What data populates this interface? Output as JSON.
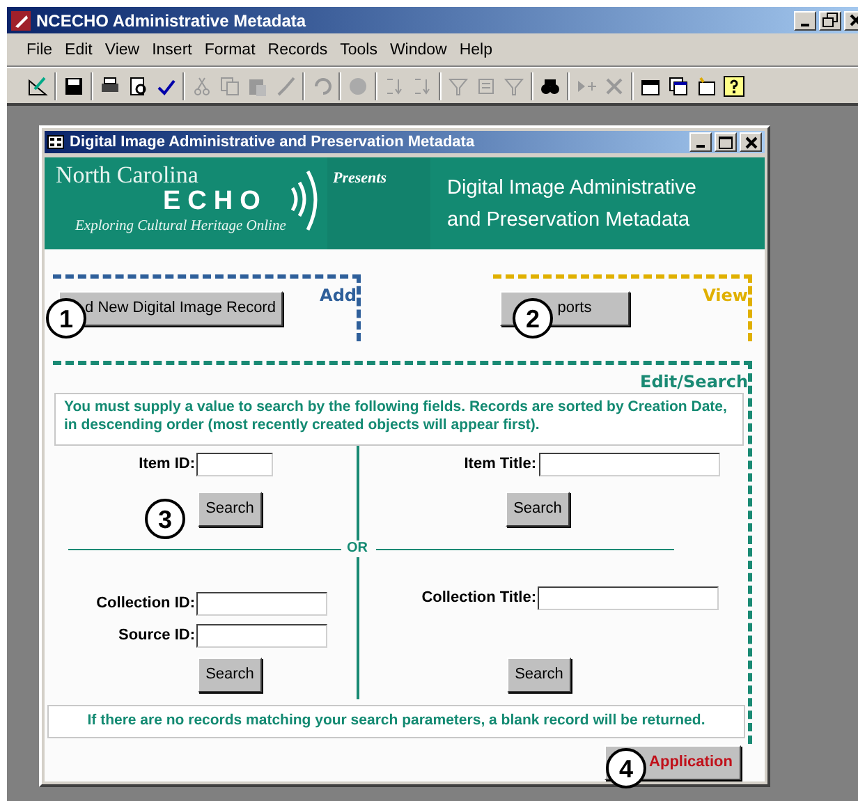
{
  "app_window": {
    "title": "NCECHO Administrative Metadata"
  },
  "menu": [
    "File",
    "Edit",
    "View",
    "Insert",
    "Format",
    "Records",
    "Tools",
    "Window",
    "Help"
  ],
  "form_window": {
    "title": "Digital Image Administrative and Preservation Metadata"
  },
  "banner": {
    "logo_line1": "North Carolina",
    "logo_line2": "ECHO",
    "logo_tagline": "Exploring Cultural Heritage Online",
    "presents": "Presents",
    "heading_line1": "Digital Image Administrative",
    "heading_line2": "and Preservation Metadata"
  },
  "sections": [
    {
      "label": "Add",
      "color": "#2e5f9a"
    },
    {
      "label": "View",
      "color": "#e0b000"
    },
    {
      "label": "Edit/Search",
      "color": "#1a8a74"
    }
  ],
  "add_button": "d New Digital Image Record",
  "reports_button": "ports",
  "notice": "You must supply a value to search by the following fields. Records are sorted by Creation Date, in descending order (most recently created objects will appear first).",
  "fields": [
    {
      "label": "Item ID:"
    },
    {
      "label": "Item Title:"
    },
    {
      "label": "Collection ID:"
    },
    {
      "label": "Collection Title:"
    },
    {
      "label": "Source ID:"
    }
  ],
  "search_buttons": [
    "Search",
    "Search",
    "Search",
    "Search"
  ],
  "or_label": "OR",
  "footer_notice": "If there are no records matching your search parameters, a blank record will be returned.",
  "application_button": "Application",
  "callouts": [
    "1",
    "2",
    "3",
    "4"
  ]
}
